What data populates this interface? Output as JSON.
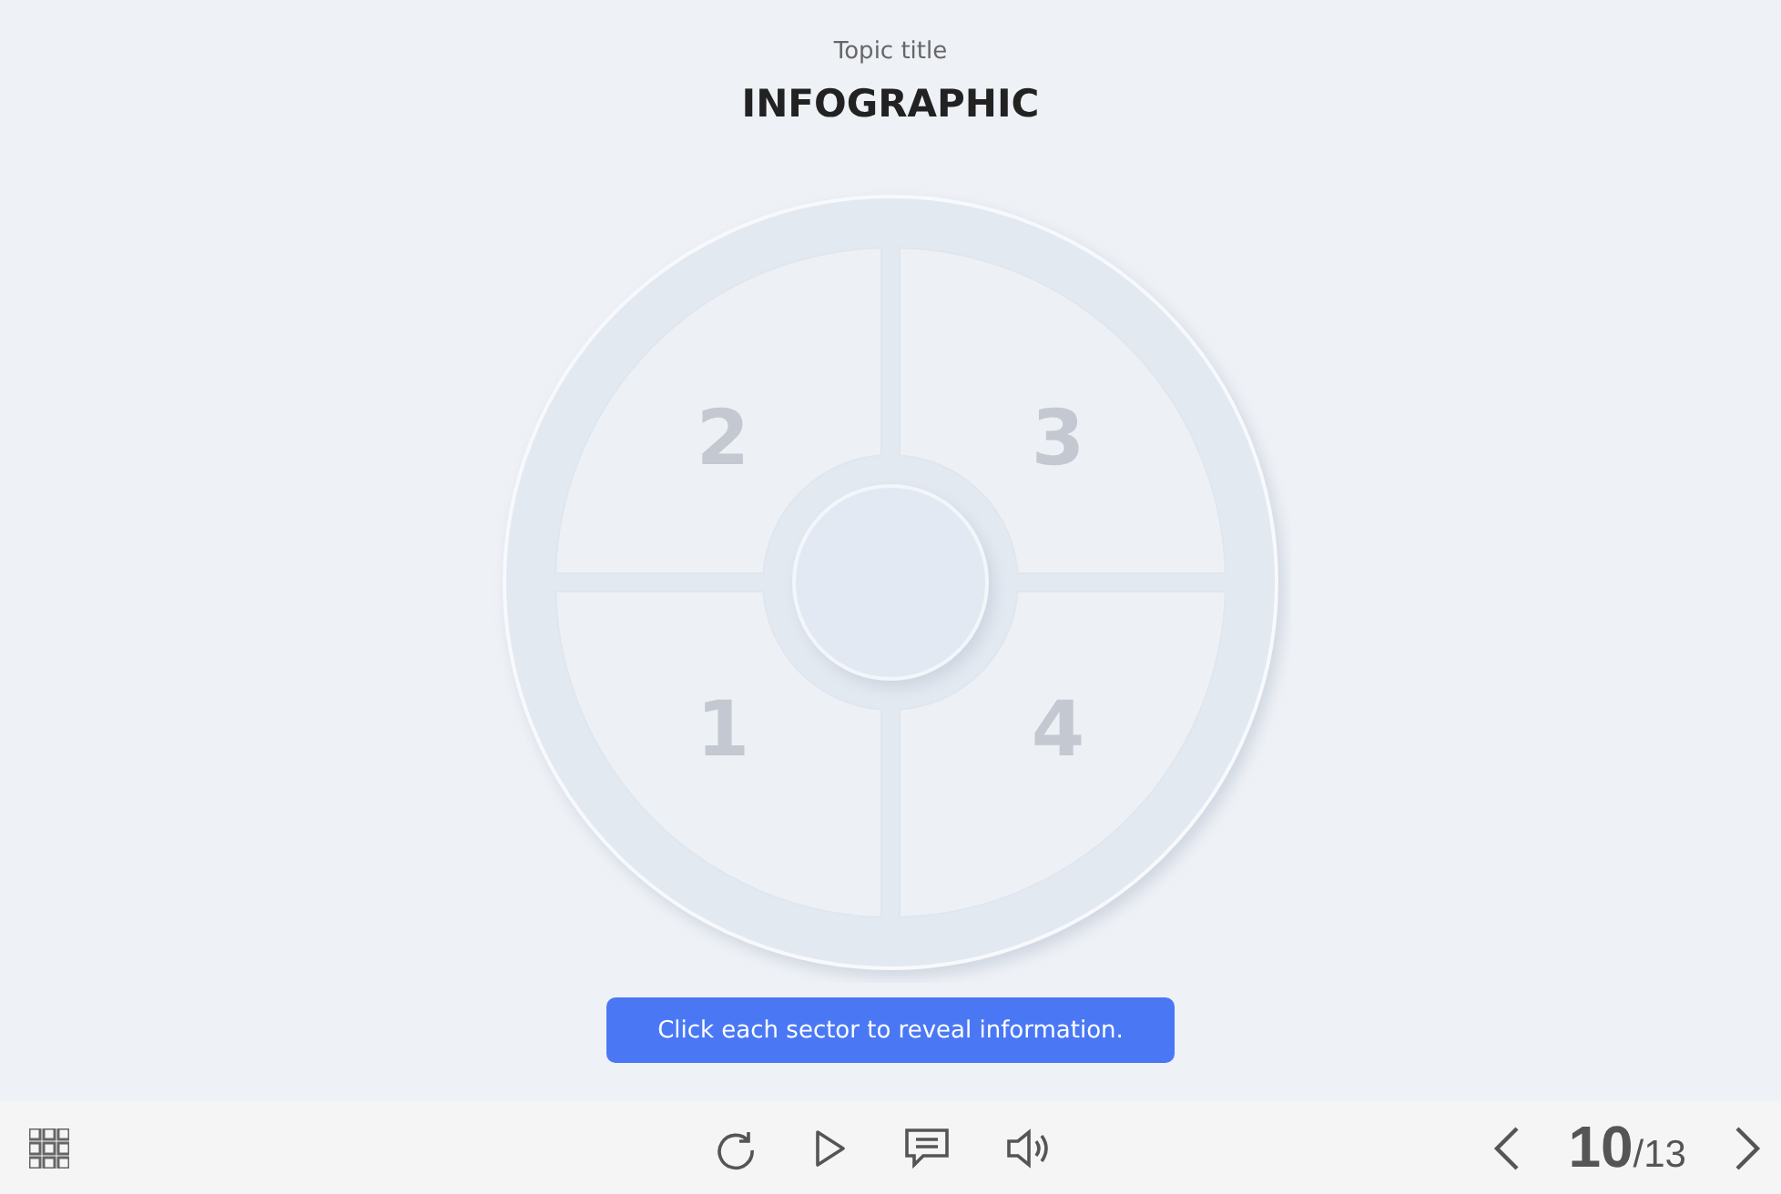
{
  "header": {
    "topic": "Topic title",
    "title": "INFOGRAPHIC"
  },
  "sectors": [
    {
      "label": "2"
    },
    {
      "label": "3"
    },
    {
      "label": "1"
    },
    {
      "label": "4"
    }
  ],
  "hint": "Click each sector to reveal information.",
  "footer": {
    "current": "10",
    "total": "/13"
  }
}
